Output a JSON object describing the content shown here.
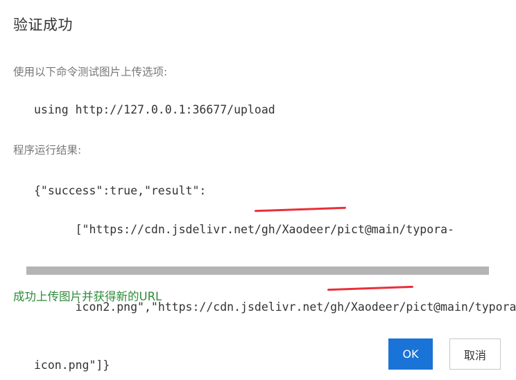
{
  "dialog": {
    "title": "验证成功",
    "command_label": "使用以下命令测试图片上传选项:",
    "command": "using http://127.0.0.1:36677/upload",
    "result_label": "程序运行结果:",
    "result_lines": [
      "{\"success\":true,\"result\":",
      "[\"https://cdn.jsdelivr.net/gh/Xaodeer/pict@main/typora-",
      "icon2.png\",\"https://cdn.jsdelivr.net/gh/Xaodeer/pict@main/typora",
      "icon.png\"]}"
    ],
    "success_message": "成功上传图片并获得新的URL",
    "ok_label": "OK",
    "cancel_label": "取消"
  },
  "colors": {
    "primary_button": "#1a73d6",
    "success_text": "#2e8b3a",
    "redaction": "#e8303a"
  }
}
